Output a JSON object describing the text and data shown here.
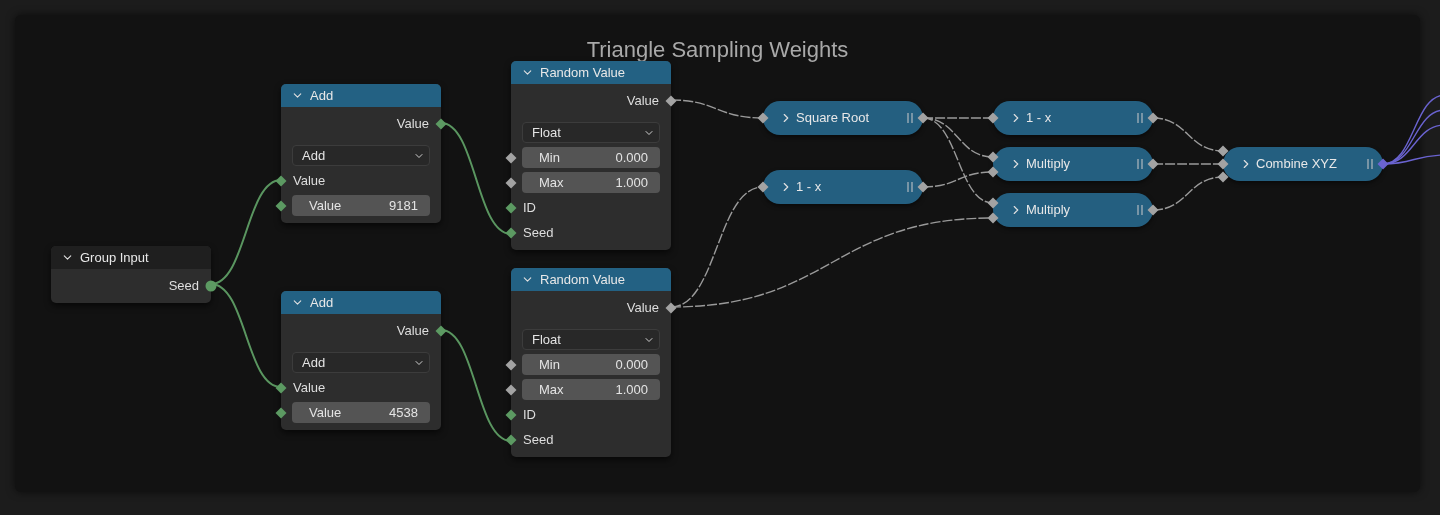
{
  "frame": {
    "title": "Triangle Sampling Weights"
  },
  "nodes": [
    {
      "kind": "input",
      "title": "Group Input",
      "expanded": true,
      "rows": [
        {
          "kind": "output",
          "label": "Seed",
          "socket": {
            "kind": "circle",
            "color": "#5c9a62"
          }
        }
      ]
    },
    {
      "kind": "function",
      "title": "Add",
      "expanded": true,
      "rows": [
        {
          "kind": "output",
          "label": "Value",
          "socket": {
            "kind": "diamond",
            "color": "#5c9a62"
          }
        },
        {
          "kind": "dropdown",
          "value": "Add"
        },
        {
          "kind": "input",
          "label": "Value",
          "socket": {
            "kind": "diamond",
            "color": "#5c9a62"
          }
        },
        {
          "kind": "field",
          "label": "Value",
          "value": "9181",
          "socket": {
            "kind": "diamond",
            "color": "#5c9a62"
          }
        }
      ]
    },
    {
      "kind": "function",
      "title": "Add",
      "expanded": true,
      "rows": [
        {
          "kind": "output",
          "label": "Value",
          "socket": {
            "kind": "diamond",
            "color": "#5c9a62"
          }
        },
        {
          "kind": "dropdown",
          "value": "Add"
        },
        {
          "kind": "input",
          "label": "Value",
          "socket": {
            "kind": "diamond",
            "color": "#5c9a62"
          }
        },
        {
          "kind": "field",
          "label": "Value",
          "value": "4538",
          "socket": {
            "kind": "diamond",
            "color": "#5c9a62"
          }
        }
      ]
    },
    {
      "kind": "function",
      "title": "Random Value",
      "expanded": true,
      "rows": [
        {
          "kind": "output",
          "label": "Value",
          "socket": {
            "kind": "diamond",
            "color": "#a3a3a3"
          }
        },
        {
          "kind": "dropdown",
          "value": "Float"
        },
        {
          "kind": "field",
          "label": "Min",
          "value": "0.000",
          "socket": {
            "kind": "diamond",
            "color": "#a3a3a3"
          }
        },
        {
          "kind": "field",
          "label": "Max",
          "value": "1.000",
          "socket": {
            "kind": "diamond",
            "color": "#a3a3a3"
          }
        },
        {
          "kind": "input",
          "label": "ID",
          "socket": {
            "kind": "diamond",
            "color": "#5c9a62"
          }
        },
        {
          "kind": "input",
          "label": "Seed",
          "socket": {
            "kind": "diamond",
            "color": "#5c9a62"
          }
        }
      ]
    },
    {
      "kind": "function",
      "title": "Random Value",
      "expanded": true,
      "rows": [
        {
          "kind": "output",
          "label": "Value",
          "socket": {
            "kind": "diamond",
            "color": "#a3a3a3"
          }
        },
        {
          "kind": "dropdown",
          "value": "Float"
        },
        {
          "kind": "field",
          "label": "Min",
          "value": "0.000",
          "socket": {
            "kind": "diamond",
            "color": "#a3a3a3"
          }
        },
        {
          "kind": "field",
          "label": "Max",
          "value": "1.000",
          "socket": {
            "kind": "diamond",
            "color": "#a3a3a3"
          }
        },
        {
          "kind": "input",
          "label": "ID",
          "socket": {
            "kind": "diamond",
            "color": "#5c9a62"
          }
        },
        {
          "kind": "input",
          "label": "Seed",
          "socket": {
            "kind": "diamond",
            "color": "#5c9a62"
          }
        }
      ]
    },
    {
      "kind": "function",
      "title": "Square Root",
      "expanded": false,
      "inputs": [
        {
          "kind": "diamond",
          "color": "#a3a3a3"
        }
      ],
      "output": {
        "kind": "diamond",
        "color": "#a3a3a3"
      }
    },
    {
      "kind": "function",
      "title": "1 - x",
      "expanded": false,
      "inputs": [
        {
          "kind": "diamond",
          "color": "#a3a3a3"
        }
      ],
      "output": {
        "kind": "diamond",
        "color": "#a3a3a3"
      }
    },
    {
      "kind": "function",
      "title": "1 - x",
      "expanded": false,
      "inputs": [
        {
          "kind": "diamond",
          "color": "#a3a3a3"
        }
      ],
      "output": {
        "kind": "diamond",
        "color": "#a3a3a3"
      }
    },
    {
      "kind": "function",
      "title": "Multiply",
      "expanded": false,
      "inputs": [
        {
          "kind": "diamond",
          "color": "#a3a3a3"
        },
        {
          "kind": "diamond",
          "color": "#a3a3a3"
        }
      ],
      "output": {
        "kind": "diamond",
        "color": "#a3a3a3"
      }
    },
    {
      "kind": "function",
      "title": "Multiply",
      "expanded": false,
      "inputs": [
        {
          "kind": "diamond",
          "color": "#a3a3a3"
        },
        {
          "kind": "diamond",
          "color": "#a3a3a3"
        }
      ],
      "output": {
        "kind": "diamond",
        "color": "#a3a3a3"
      }
    },
    {
      "kind": "function",
      "title": "Combine XYZ",
      "expanded": false,
      "inputs": [
        {
          "kind": "diamond",
          "color": "#a3a3a3"
        },
        {
          "kind": "diamond",
          "color": "#a3a3a3"
        },
        {
          "kind": "diamond",
          "color": "#a3a3a3"
        }
      ],
      "output": {
        "kind": "diamond",
        "color": "#6a63d0"
      }
    }
  ]
}
